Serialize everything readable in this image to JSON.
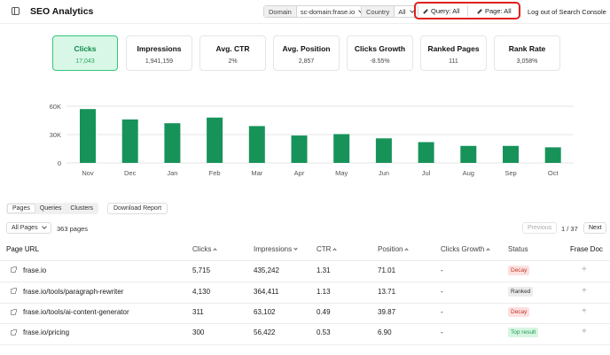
{
  "header": {
    "title": "SEO Analytics",
    "domain_label": "Domain",
    "domain_value": "sc-domain:frase.io",
    "country_label": "Country",
    "country_value": "All",
    "query_filter": "Query: All",
    "page_filter": "Page: All",
    "logout": "Log out of Search Console"
  },
  "metrics": [
    {
      "title": "Clicks",
      "value": "17,043"
    },
    {
      "title": "Impressions",
      "value": "1,941,159"
    },
    {
      "title": "Avg. CTR",
      "value": "2%"
    },
    {
      "title": "Avg. Position",
      "value": "2,857"
    },
    {
      "title": "Clicks Growth",
      "value": "-8.55%"
    },
    {
      "title": "Ranked Pages",
      "value": "111"
    },
    {
      "title": "Rank Rate",
      "value": "3,058%"
    }
  ],
  "chart_data": {
    "type": "bar",
    "categories": [
      "Nov",
      "Dec",
      "Jan",
      "Feb",
      "Mar",
      "Apr",
      "May",
      "Jun",
      "Jul",
      "Aug",
      "Sep",
      "Oct"
    ],
    "values": [
      57000,
      46000,
      42000,
      48000,
      39000,
      29000,
      30500,
      26000,
      22000,
      18000,
      18000,
      16500
    ],
    "ytick_labels": [
      "0",
      "30K",
      "60K"
    ],
    "ylim": [
      0,
      60000
    ],
    "bar_color": "#17935a",
    "grid": true
  },
  "tabs": [
    "Pages",
    "Queries",
    "Clusters"
  ],
  "download_label": "Download Report",
  "filter_all_pages": "All Pages",
  "page_count": "363 pages",
  "pagination": {
    "prev": "Previous",
    "info": "1 / 37",
    "next": "Next"
  },
  "table": {
    "headers": [
      "Page URL",
      "Clicks",
      "Impressions",
      "CTR",
      "Position",
      "Clicks Growth",
      "Status",
      "Frase Doc"
    ],
    "rows": [
      {
        "url": "frase.io",
        "clicks": "5,715",
        "impressions": "435,242",
        "ctr": "1.31",
        "position": "71.01",
        "growth": "-",
        "status": "Decay",
        "doc": "+"
      },
      {
        "url": "frase.io/tools/paragraph-rewriter",
        "clicks": "4,130",
        "impressions": "364,411",
        "ctr": "1.13",
        "position": "13.71",
        "growth": "-",
        "status": "Ranked",
        "doc": "+"
      },
      {
        "url": "frase.io/tools/ai-content-generator",
        "clicks": "311",
        "impressions": "63,102",
        "ctr": "0.49",
        "position": "39.87",
        "growth": "-",
        "status": "Decay",
        "doc": "+"
      },
      {
        "url": "frase.io/pricing",
        "clicks": "300",
        "impressions": "56,422",
        "ctr": "0.53",
        "position": "6.90",
        "growth": "-",
        "status": "Top result",
        "doc": "+"
      }
    ]
  }
}
